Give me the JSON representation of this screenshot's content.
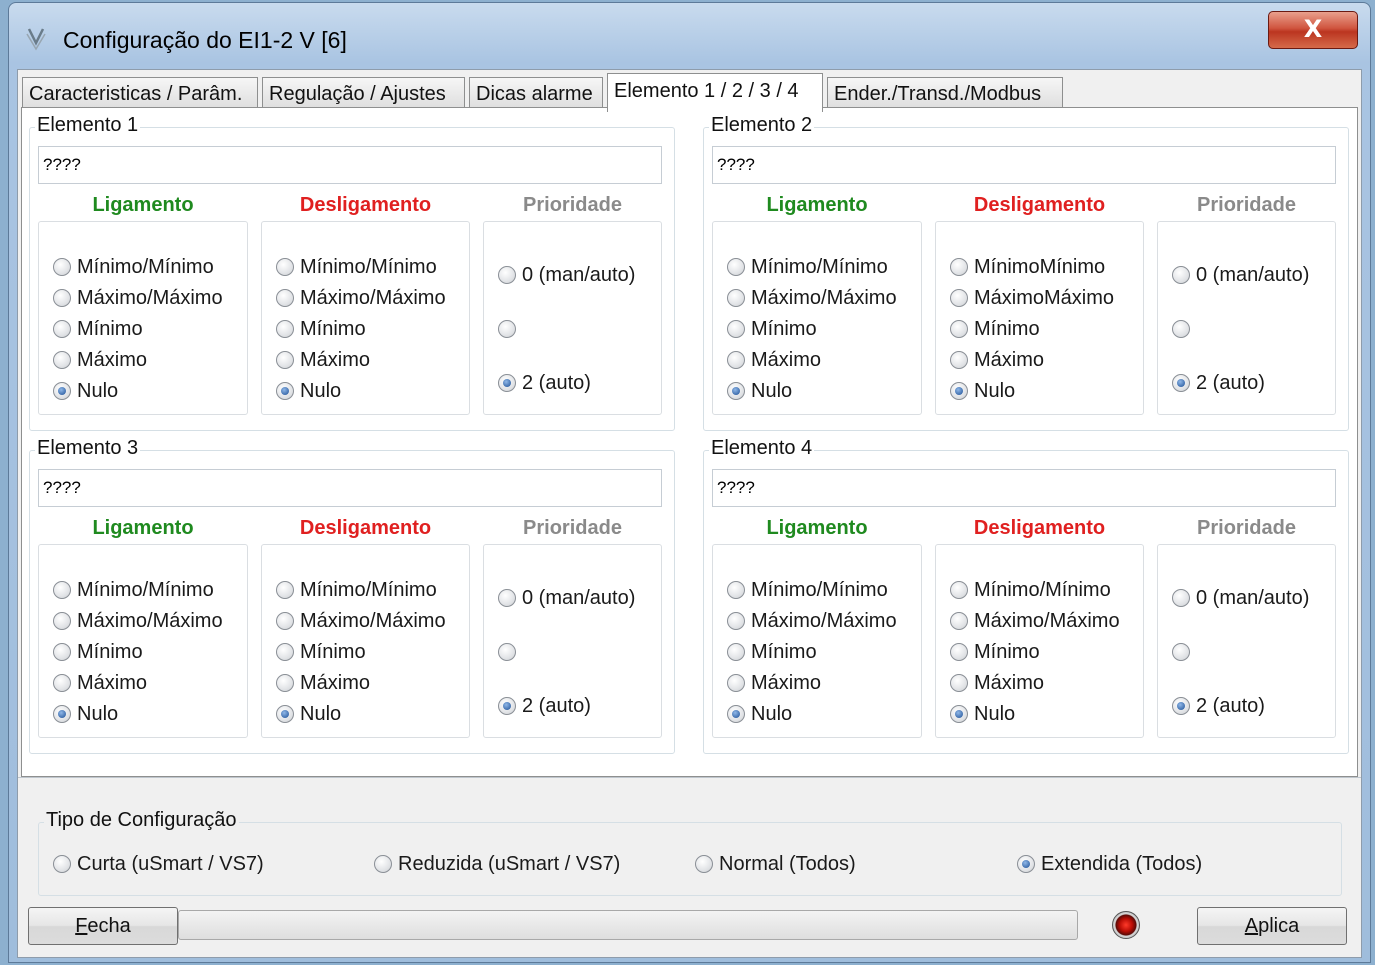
{
  "window": {
    "title": "Configuração do EI1-2 V  [6]",
    "close_label": "X"
  },
  "tabs": [
    {
      "label": "Caracteristicas / Parâm.",
      "active": false
    },
    {
      "label": "Regulação / Ajustes",
      "active": false
    },
    {
      "label": "Dicas alarme",
      "active": false
    },
    {
      "label": "Elemento 1 / 2 / 3 / 4",
      "active": true
    },
    {
      "label": "Ender./Transd./Modbus",
      "active": false
    }
  ],
  "headers": {
    "on": "Ligamento",
    "off": "Desligamento",
    "priority": "Prioridade"
  },
  "elements": [
    {
      "title": "Elemento 1",
      "name": "????",
      "on": [
        "Mínimo/Mínimo",
        "Máximo/Máximo",
        "Mínimo",
        "Máximo",
        "Nulo"
      ],
      "off": [
        "Mínimo/Mínimo",
        "Máximo/Máximo",
        "Mínimo",
        "Máximo",
        "Nulo"
      ],
      "priority": [
        "0 (man/auto)",
        "",
        "2 (auto)"
      ],
      "on_selected": "Nulo",
      "off_selected": "Nulo",
      "priority_selected": "2 (auto)"
    },
    {
      "title": "Elemento 2",
      "name": "????",
      "on": [
        "Mínimo/Mínimo",
        "Máximo/Máximo",
        "Mínimo",
        "Máximo",
        "Nulo"
      ],
      "off": [
        "MínimoMínimo",
        "MáximoMáximo",
        "Mínimo",
        "Máximo",
        "Nulo"
      ],
      "priority": [
        "0 (man/auto)",
        "",
        "2 (auto)"
      ],
      "on_selected": "Nulo",
      "off_selected": "Nulo",
      "priority_selected": "2 (auto)"
    },
    {
      "title": "Elemento 3",
      "name": "????",
      "on": [
        "Mínimo/Mínimo",
        "Máximo/Máximo",
        "Mínimo",
        "Máximo",
        "Nulo"
      ],
      "off": [
        "Mínimo/Mínimo",
        "Máximo/Máximo",
        "Mínimo",
        "Máximo",
        "Nulo"
      ],
      "priority": [
        "0 (man/auto)",
        "",
        "2 (auto)"
      ],
      "on_selected": "Nulo",
      "off_selected": "Nulo",
      "priority_selected": "2 (auto)"
    },
    {
      "title": "Elemento 4",
      "name": "????",
      "on": [
        "Mínimo/Mínimo",
        "Máximo/Máximo",
        "Mínimo",
        "Máximo",
        "Nulo"
      ],
      "off": [
        "Mínimo/Mínimo",
        "Máximo/Máximo",
        "Mínimo",
        "Máximo",
        "Nulo"
      ],
      "priority": [
        "0 (man/auto)",
        "",
        "2 (auto)"
      ],
      "on_selected": "Nulo",
      "off_selected": "Nulo",
      "priority_selected": "2 (auto)"
    }
  ],
  "config_type": {
    "title": "Tipo de Configuração",
    "options": [
      "Curta (uSmart / VS7)",
      "Reduzida (uSmart / VS7)",
      "Normal (Todos)",
      "Extendida (Todos)"
    ],
    "selected": "Extendida (Todos)"
  },
  "buttons": {
    "close": {
      "mnemonic": "F",
      "rest": "echa"
    },
    "apply": {
      "mnemonic": "A",
      "rest": "plica"
    }
  },
  "progress": 0,
  "status_led_color": "#d0160c"
}
